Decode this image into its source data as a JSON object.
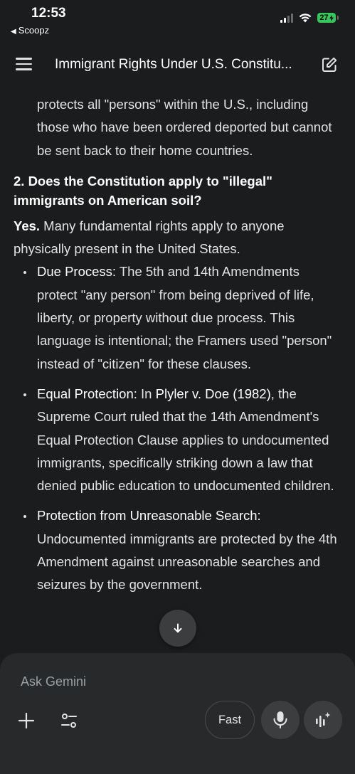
{
  "status_bar": {
    "time": "12:53",
    "back_label": "Scoopz",
    "battery": "27"
  },
  "header": {
    "title": "Immigrant Rights Under U.S. Constitu..."
  },
  "content": {
    "continuation": "protects all \"persons\" within the U.S., including those who have been ordered deported but cannot be sent back to their home countries.",
    "section_heading": "2. Does the Constitution apply to \"illegal\" immigrants on American soil?",
    "answer_bold": "Yes.",
    "answer_text": " Many fundamental rights apply to anyone physically present in the United States.",
    "bullets": [
      {
        "term": "Due Process:",
        "text": " The 5th and 14th Amendments protect \"any person\" from being deprived of life, liberty, or property without due process. This language is intentional; the Framers used \"person\" instead of \"citizen\" for these clauses."
      },
      {
        "term": "Equal Protection:",
        "text_before": " In ",
        "case": "Plyler v. Doe (1982)",
        "text_after": ", the Supreme Court ruled that the 14th Amendment's Equal Protection Clause applies to undocumented immigrants, specifically striking down a law that denied public education to undocumented children."
      },
      {
        "term": "Protection from Unreasonable Search:",
        "text": " Undocumented immigrants are protected by the 4th Amendment against unreasonable searches and seizures by the government."
      }
    ]
  },
  "composer": {
    "placeholder": "Ask Gemini",
    "mode_label": "Fast"
  },
  "icons": {
    "menu": "hamburger-menu-icon",
    "new_chat": "edit-icon",
    "scroll_down": "arrow-down-icon",
    "plus": "plus-icon",
    "tools": "tune-icon",
    "mic": "microphone-icon",
    "live": "sparkle-waveform-icon"
  }
}
